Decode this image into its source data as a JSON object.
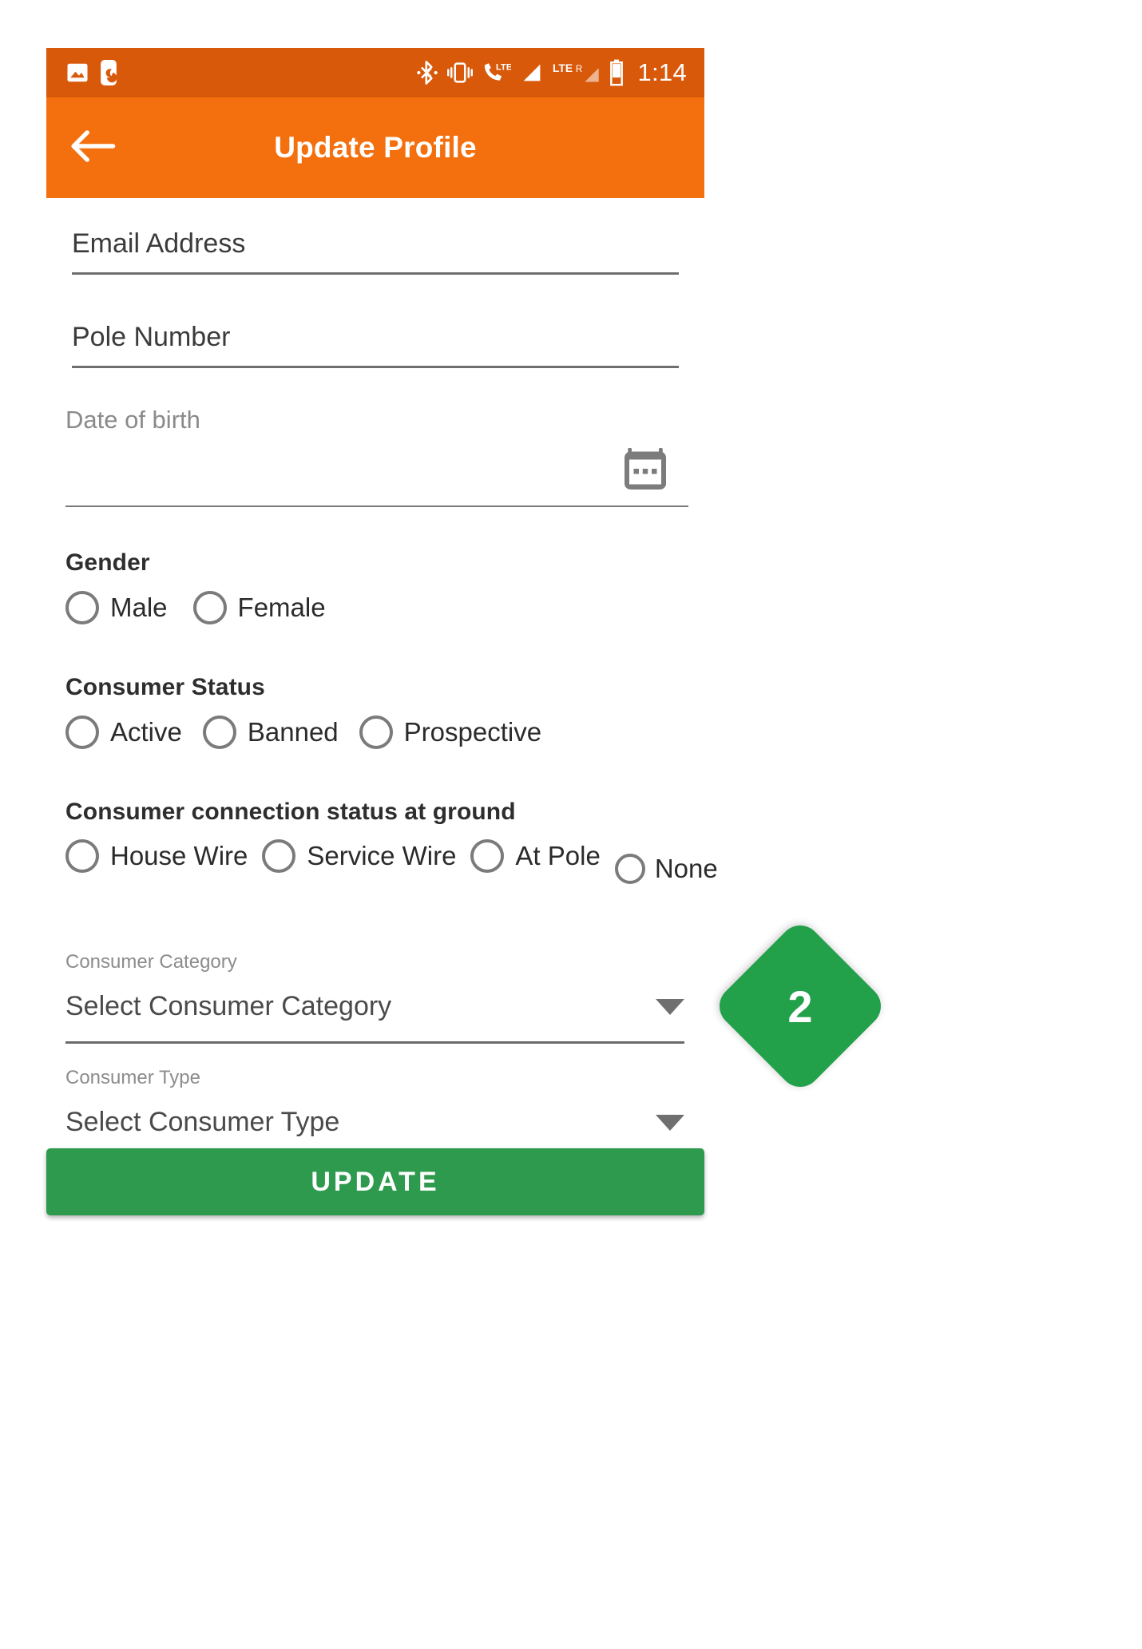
{
  "statusbar": {
    "time": "1:14",
    "icons": [
      "photo-icon",
      "do-not-disturb-moon-icon",
      "bluetooth-icon",
      "vibrate-icon",
      "volte-call-icon",
      "signal-bars-icon",
      "lte-roaming-label",
      "signal-bars-secondary-icon",
      "battery-icon"
    ],
    "lte_label": "LTE",
    "roaming_label": "R",
    "bg_color": "#d9590b"
  },
  "appbar": {
    "title": "Update Profile",
    "back_icon": "back-arrow-icon",
    "bg_color": "#f4700e"
  },
  "form": {
    "email": {
      "placeholder": "Email Address",
      "value": ""
    },
    "pole_number": {
      "placeholder": "Pole Number",
      "value": ""
    },
    "date_of_birth": {
      "label": "Date of birth",
      "value": "",
      "icon": "calendar-icon"
    },
    "gender": {
      "title": "Gender",
      "options": [
        "Male",
        "Female"
      ],
      "selected": null
    },
    "consumer_status": {
      "title": "Consumer Status",
      "options": [
        "Active",
        "Banned",
        "Prospective"
      ],
      "selected": null
    },
    "connection_status": {
      "title": "Consumer connection status at ground",
      "options": [
        "House Wire",
        "Service Wire",
        "At Pole",
        "None"
      ],
      "selected": null
    },
    "consumer_category": {
      "label": "Consumer Category",
      "value": "Select Consumer Category",
      "caret": "chevron-down-icon"
    },
    "consumer_type": {
      "label": "Consumer Type",
      "value": "Select Consumer Type",
      "caret": "chevron-down-icon"
    }
  },
  "badge": {
    "number": "2",
    "color": "#22a04a"
  },
  "submit": {
    "label": "UPDATE",
    "color": "#2e9a4e"
  }
}
